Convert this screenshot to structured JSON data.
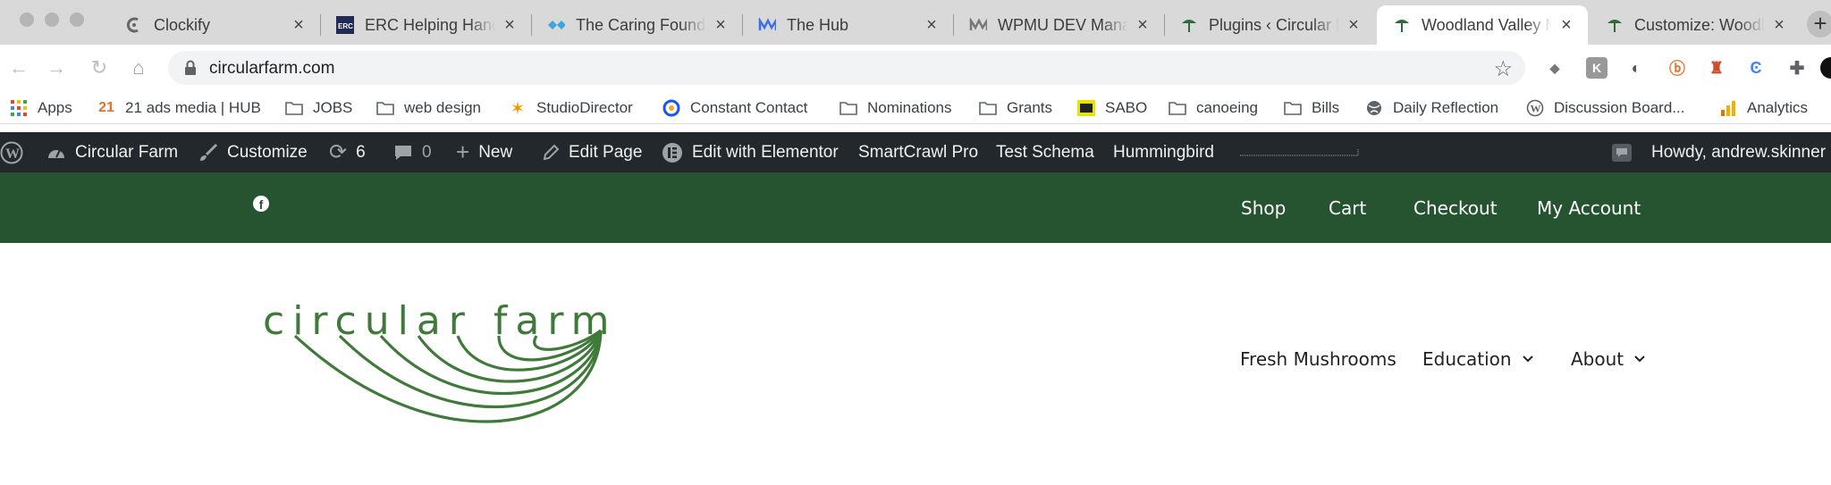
{
  "browser": {
    "tabs": [
      {
        "title": "Clockify",
        "icon": "clockify-icon",
        "active": false
      },
      {
        "title": "ERC Helping Hands",
        "icon": "erc-icon",
        "active": false
      },
      {
        "title": "The Caring Foundation",
        "icon": "caring-foundation-icon",
        "active": false
      },
      {
        "title": "The Hub",
        "icon": "hub-icon",
        "active": false
      },
      {
        "title": "WPMU DEV Manage",
        "icon": "wpmudev-icon",
        "active": false
      },
      {
        "title": "Plugins ‹ Circular Farm",
        "icon": "mushroom-icon",
        "active": false
      },
      {
        "title": "Woodland Valley Mushrooms",
        "icon": "mushroom-icon",
        "active": true
      },
      {
        "title": "Customize: Woodland",
        "icon": "mushroom-icon",
        "active": false
      }
    ],
    "url": "circularfarm.com",
    "bookmarks": [
      {
        "label": "Apps",
        "icon": "apps-grid-icon"
      },
      {
        "label": "21 ads media | HUB",
        "icon": "21-ads-icon"
      },
      {
        "label": "JOBS",
        "icon": "folder-icon"
      },
      {
        "label": "web design",
        "icon": "folder-icon"
      },
      {
        "label": "StudioDirector",
        "icon": "studiodirector-icon"
      },
      {
        "label": "Constant Contact",
        "icon": "constant-contact-icon"
      },
      {
        "label": "Nominations",
        "icon": "folder-icon"
      },
      {
        "label": "Grants",
        "icon": "folder-icon"
      },
      {
        "label": "SABO",
        "icon": "sabo-icon"
      },
      {
        "label": "canoeing",
        "icon": "folder-icon"
      },
      {
        "label": "Bills",
        "icon": "folder-icon"
      },
      {
        "label": "Daily Reflection",
        "icon": "globe-icon"
      },
      {
        "label": "Discussion Board...",
        "icon": "wordpress-icon"
      },
      {
        "label": "Analytics",
        "icon": "analytics-icon"
      }
    ],
    "bookmark_21_prefix": "21"
  },
  "adminbar": {
    "site_name": "Circular Farm",
    "customize": "Customize",
    "updates_count": "6",
    "comments_count": "0",
    "new": "New",
    "edit_page": "Edit Page",
    "elementor": "Edit with Elementor",
    "smartcrawl": "SmartCrawl Pro",
    "test_schema": "Test Schema",
    "hummingbird": "Hummingbird",
    "howdy": "Howdy, andrew.skinner"
  },
  "site": {
    "top_nav": [
      "Shop",
      "Cart",
      "Checkout",
      "My Account"
    ],
    "logo_text": "circular farm",
    "main_nav": [
      {
        "label": "Fresh Mushrooms",
        "dropdown": false
      },
      {
        "label": "Education",
        "dropdown": true
      },
      {
        "label": "About",
        "dropdown": true
      }
    ]
  },
  "colors": {
    "brand_green": "#265431",
    "logo_green": "#3f7a3b",
    "adminbar": "#23282d"
  }
}
